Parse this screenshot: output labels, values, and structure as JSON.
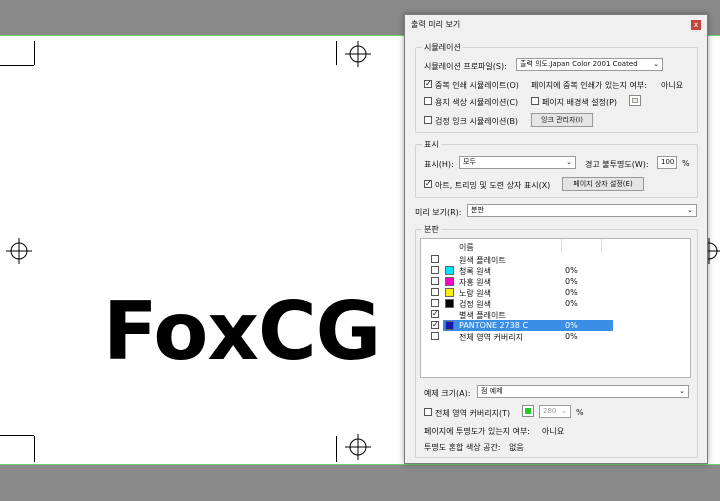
{
  "canvas": {
    "logo_text": "FoxCG"
  },
  "dialog": {
    "title": "출력 미리 보기",
    "close_glyph": "x",
    "simulation": {
      "group_label": "시뮬레이션",
      "profile_label": "시뮬레이션 프로파일(S):",
      "profile_value": "출력 의도:Japan Color 2001 Coated",
      "overprint_label": "중복 인쇄 시뮬레이트(O)",
      "overprint_checked": true,
      "page_overprint_label": "페이지에 중복 인쇄가 있는지 여부:",
      "page_overprint_value": "아니요",
      "paper_color_label": "용지 색상 시뮬레이션(C)",
      "page_bg_label": "페이지 배경색 설정(P)",
      "black_ink_label": "검정 잉크 시뮬레이션(B)",
      "ink_manager_label": "잉크 관리자(I)"
    },
    "show": {
      "group_label": "표시",
      "show_label": "표시(H):",
      "show_value": "모두",
      "warning_opacity_label": "경고 불투명도(W):",
      "warning_opacity_value": "100",
      "percent": "%",
      "art_trim_label": "아트, 트리밍 및 도련 상자 표시(X)",
      "art_trim_checked": true,
      "page_box_button": "페이지 상자 설정(E)"
    },
    "preview": {
      "label": "미리 보기(R):",
      "value": "분판"
    },
    "separations": {
      "group_label": "분판",
      "column_name": "이름",
      "rows": [
        {
          "name": "원색 플레이트",
          "pct": "",
          "checked": false,
          "color": ""
        },
        {
          "name": "청록 원색",
          "pct": "0%",
          "checked": false,
          "color": "#00e5ff"
        },
        {
          "name": "자홍 원색",
          "pct": "0%",
          "checked": false,
          "color": "#ff00c8"
        },
        {
          "name": "노랑 원색",
          "pct": "0%",
          "checked": false,
          "color": "#ffee00"
        },
        {
          "name": "검정 원색",
          "pct": "0%",
          "checked": false,
          "color": "#000000"
        },
        {
          "name": "별색 플레이트",
          "pct": "",
          "checked": true,
          "color": ""
        },
        {
          "name": "PANTONE 2738 C",
          "pct": "0%",
          "checked": true,
          "color": "#1a1aa8",
          "selected": true
        },
        {
          "name": "전체 영역 커버리지",
          "pct": "0%",
          "checked": false,
          "color": ""
        }
      ],
      "sample_size_label": "예제 크기(A):",
      "sample_size_value": "점 예제",
      "total_coverage_label": "전체 영역 커버리지(T)",
      "total_coverage_color": "#22cc22",
      "total_coverage_value": "280",
      "percent": "%",
      "page_transparency_label": "페이지에 투명도가 있는지 여부:",
      "page_transparency_value": "아니요",
      "blend_space_label": "투명도 혼합 색상 공간:",
      "blend_space_value": "없음"
    }
  }
}
